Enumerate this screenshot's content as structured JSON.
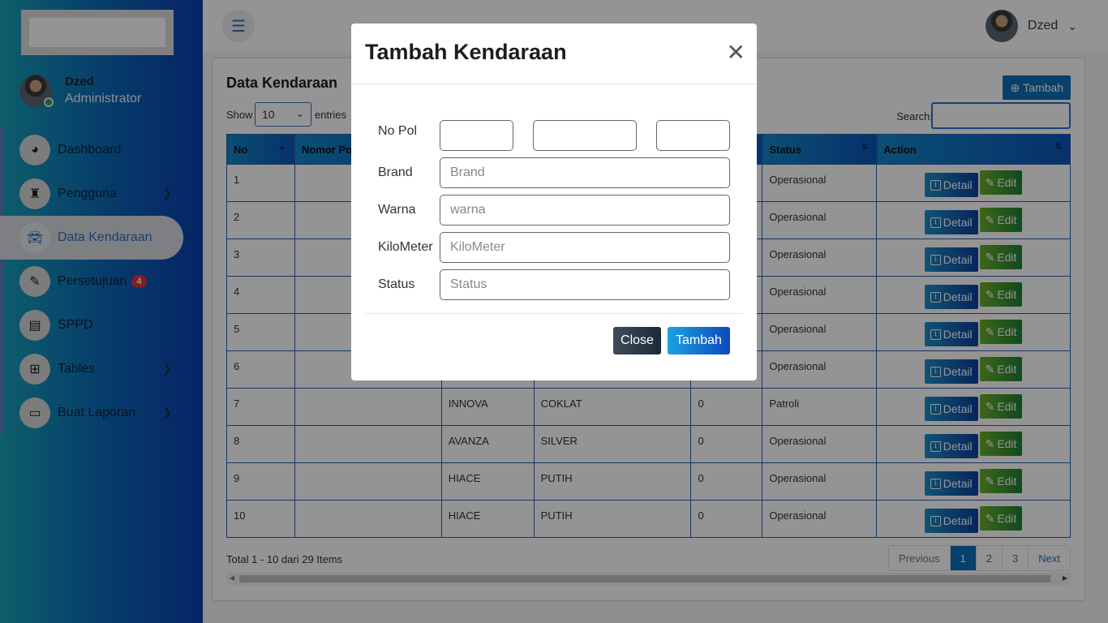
{
  "user": {
    "name": "Dzed",
    "role": "Administrator"
  },
  "sidebar": {
    "items": [
      {
        "label": "Dashboard",
        "icon": "dashboard-icon"
      },
      {
        "label": "Pengguna",
        "icon": "user-secret-icon",
        "has_children": true
      },
      {
        "label": "Data Kendaraan",
        "icon": "car-icon",
        "active": true
      },
      {
        "label": "Persetujuan",
        "icon": "pen-icon",
        "badge": "4"
      },
      {
        "label": "SPPD",
        "icon": "receipt-icon"
      },
      {
        "label": "Tables",
        "icon": "table-icon",
        "has_children": true
      },
      {
        "label": "Buat Laporan",
        "icon": "folder-open-icon",
        "has_children": true
      }
    ]
  },
  "page": {
    "title": "Data Kendaraan",
    "add_button": "Tambah",
    "show_label": "Show",
    "entries_select": "10",
    "entries_label": "entries",
    "search_label": "Search:",
    "search_value": ""
  },
  "table": {
    "columns": [
      "No",
      "Nomor Pol",
      "",
      "",
      "",
      "Status",
      "Action"
    ],
    "rows": [
      {
        "no": "1",
        "brand": "",
        "warna": "",
        "km": "",
        "status": "Operasional"
      },
      {
        "no": "2",
        "brand": "",
        "warna": "",
        "km": "",
        "status": "Operasional"
      },
      {
        "no": "3",
        "brand": "",
        "warna": "",
        "km": "",
        "status": "Operasional"
      },
      {
        "no": "4",
        "brand": "",
        "warna": "",
        "km": "",
        "status": "Operasional"
      },
      {
        "no": "5",
        "brand": "",
        "warna": "",
        "km": "",
        "status": "Operasional"
      },
      {
        "no": "6",
        "brand": "",
        "warna": "",
        "km": "",
        "status": "Operasional"
      },
      {
        "no": "7",
        "brand": "INNOVA",
        "warna": "COKLAT",
        "km": "0",
        "status": "Patroli"
      },
      {
        "no": "8",
        "brand": "AVANZA",
        "warna": "SILVER",
        "km": "0",
        "status": "Operasional"
      },
      {
        "no": "9",
        "brand": "HIACE",
        "warna": "PUTIH",
        "km": "0",
        "status": "Operasional"
      },
      {
        "no": "10",
        "brand": "HIACE",
        "warna": "PUTIH",
        "km": "0",
        "status": "Operasional"
      }
    ],
    "detail_label": "Detail",
    "edit_label": "Edit"
  },
  "footer": {
    "total": "Total 1 - 10 dari 29 Items",
    "pager": [
      "Previous",
      "1",
      "2",
      "3",
      "Next"
    ],
    "current_page": "1"
  },
  "modal": {
    "title": "Tambah Kendaraan",
    "fields": [
      {
        "label": "No Pol",
        "placeholder": ""
      },
      {
        "label": "Brand",
        "placeholder": "Brand"
      },
      {
        "label": "Warna",
        "placeholder": "warna"
      },
      {
        "label": "KiloMeter",
        "placeholder": "KiloMeter"
      },
      {
        "label": "Status",
        "placeholder": "Status"
      }
    ],
    "close_button": "Close",
    "submit_button": "Tambah"
  },
  "colors": {
    "accent": "#0d6fb8",
    "danger": "#dc3545",
    "success": "#28a745"
  }
}
